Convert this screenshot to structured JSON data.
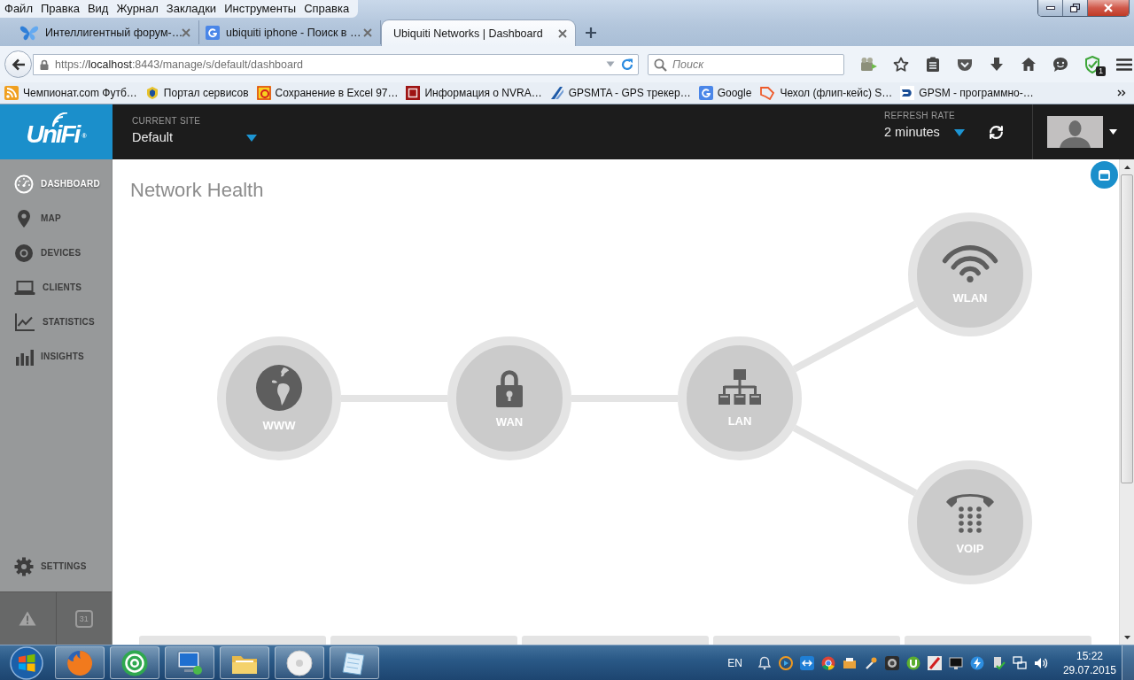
{
  "menu_bar": [
    "Файл",
    "Правка",
    "Вид",
    "Журнал",
    "Закладки",
    "Инструменты",
    "Справка"
  ],
  "tabs": [
    {
      "title": "Интеллигентный форум-…",
      "selected": false
    },
    {
      "title": "ubiquiti iphone - Поиск в …",
      "selected": false
    },
    {
      "title": "Ubiquiti Networks | Dashboard",
      "selected": true
    }
  ],
  "address_bar": {
    "url": "https://localhost:8443/manage/s/default/dashboard"
  },
  "search_field": {
    "placeholder": "Поиск"
  },
  "toolbar": {
    "badge": "1"
  },
  "bookmarks": [
    "Чемпионат.com Футб…",
    "Портал сервисов",
    "Сохранение в Excel 97…",
    "Информация о NVRA…",
    "GPSMTA - GPS трекер…",
    "Google",
    "Чехол (флип-кейс) S…",
    "GPSM - программно-…"
  ],
  "header": {
    "logo": "UniFi$^{®}$",
    "current_site": {
      "label": "CURRENT SITE",
      "value": "Default"
    },
    "refresh_rate": {
      "label": "REFRESH RATE",
      "value": "2 minutes"
    }
  },
  "sidebar": {
    "items": [
      {
        "label": "DASHBOARD",
        "selected": true
      },
      {
        "label": "MAP",
        "selected": false
      },
      {
        "label": "DEVICES",
        "selected": false
      },
      {
        "label": "CLIENTS",
        "selected": false
      },
      {
        "label": "STATISTICS",
        "selected": false
      },
      {
        "label": "INSIGHTS",
        "selected": false
      }
    ],
    "bottom_items": [
      {
        "label": "SETTINGS",
        "selected": false
      }
    ],
    "calendar_day": "31"
  },
  "main": {
    "title": "Network Health",
    "topology": [
      {
        "label": "WWW",
        "children": [
          {
            "label": "WAN",
            "children": [
              {
                "label": "LAN",
                "children": [
                  {
                    "label": "WLAN"
                  },
                  {
                    "label": "VOIP"
                  }
                ]
              }
            ]
          }
        ]
      }
    ]
  },
  "taskbar": {
    "language": "EN",
    "time": "15:22",
    "date": "29.07.2015"
  }
}
